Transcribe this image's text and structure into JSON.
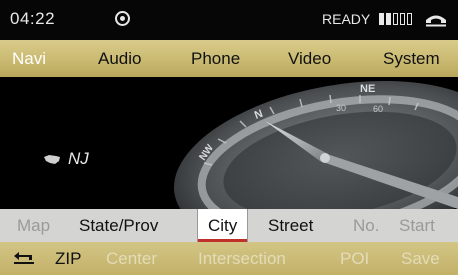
{
  "status": {
    "time": "04:22",
    "ready": "READY",
    "signal_bars_filled": 2,
    "signal_bars_total": 5
  },
  "main_menu": {
    "items": [
      "Navi",
      "Audio",
      "Phone",
      "Video",
      "System"
    ],
    "active": "Navi"
  },
  "map": {
    "state_label": "NJ",
    "compass_labels": {
      "northeast": "NE",
      "north": "N",
      "northwest": "NW",
      "ticks": [
        "30",
        "60"
      ]
    }
  },
  "submenu": {
    "items": [
      "Map",
      "State/Prov",
      "City",
      "Street",
      "No.",
      "Start"
    ],
    "selected": "City",
    "disabled": [
      "Map",
      "No.",
      "Start"
    ]
  },
  "bottom_bar": {
    "items": [
      "ZIP",
      "Center",
      "Intersection",
      "POI",
      "Save"
    ],
    "disabled": [
      "Center",
      "Intersection",
      "POI",
      "Save"
    ]
  },
  "colors": {
    "menu_bar": "#cdbd76",
    "submenu_bg": "#d4d4d2",
    "selection_underline": "#c0302a"
  },
  "icons": [
    "target-icon",
    "signal-strength-icon",
    "phone-handset-icon",
    "us-map-icon",
    "back-arrow-icon",
    "compass"
  ]
}
